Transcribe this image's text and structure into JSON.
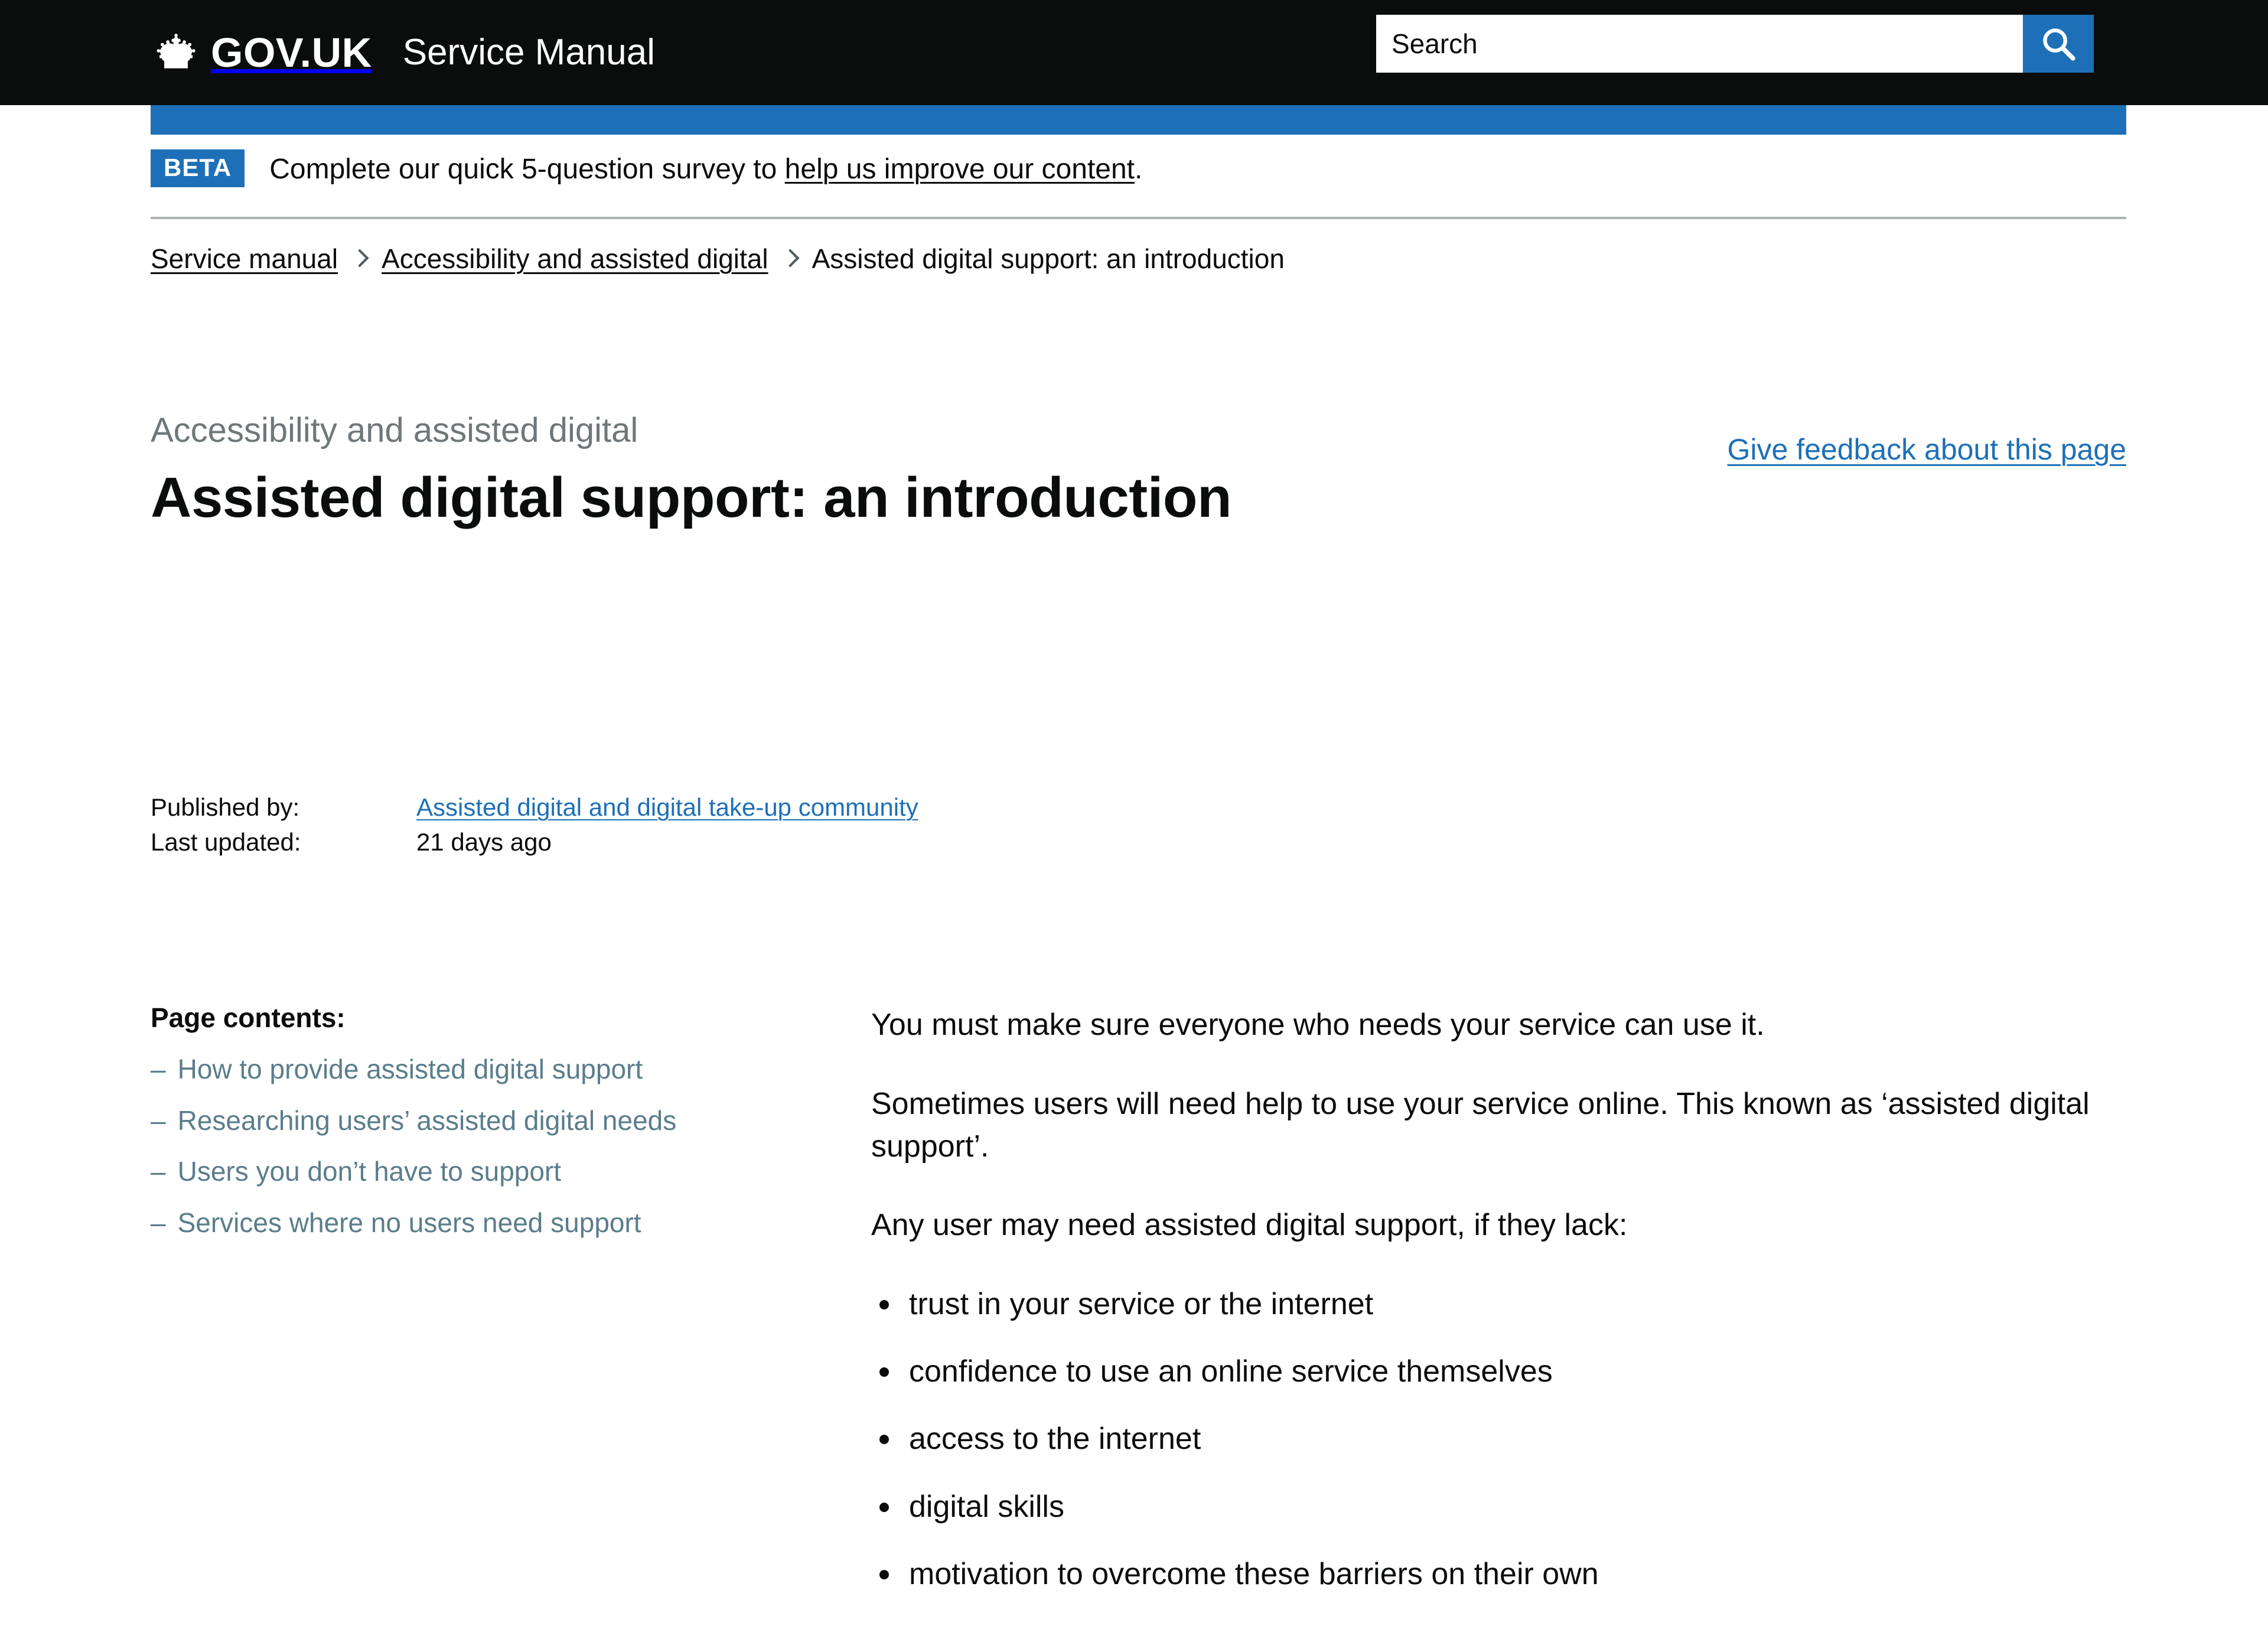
{
  "header": {
    "brand": "GOV.UK",
    "service_name": "Service Manual",
    "crown_icon": "crown-icon",
    "search": {
      "placeholder": "Search",
      "value": "",
      "button_icon": "search-icon",
      "button_color": "#1d70b8"
    }
  },
  "phase_banner": {
    "tag": "BETA",
    "text_before": "Complete our quick 5-question survey to",
    "link": "help us improve our content",
    "text_after": "."
  },
  "breadcrumbs": [
    {
      "label": "Service manual",
      "is_link": true
    },
    {
      "label": "Accessibility and assisted digital",
      "is_link": true
    },
    {
      "label": "Assisted digital support: an introduction",
      "is_link": false
    }
  ],
  "title_block": {
    "context": "Accessibility and assisted digital",
    "title": "Assisted digital support: an introduction",
    "feedback_link": "Give feedback about this page"
  },
  "meta": {
    "published_by_label": "Published by:",
    "published_by_value": "Assisted digital and digital take-up community",
    "last_updated_label": "Last updated:",
    "last_updated_value": "21 days ago"
  },
  "contents": {
    "heading": "Page contents:",
    "items": [
      "How to provide assisted digital support",
      "Researching users’ assisted digital needs",
      "Users you don’t have to support",
      "Services where no users need support"
    ]
  },
  "body": {
    "paragraphs": [
      "You must make sure everyone who needs your service can use it.",
      "Sometimes users will need help to use your service online. This known as ‘assisted digital support’.",
      "Any user may need assisted digital support, if they lack:"
    ],
    "bullets": [
      "trust in your service or the internet",
      "confidence to use an online service themselves",
      "access to the internet",
      "digital skills",
      "motivation to overcome these barriers on their own"
    ]
  },
  "colors": {
    "header_background": "#0b0c0c",
    "accent_blue": "#1d70b8",
    "link_blue": "#1d70b8",
    "contents_link": "#5a7d8b",
    "muted_grey": "#6f777b",
    "divider": "#b1b4b6"
  }
}
